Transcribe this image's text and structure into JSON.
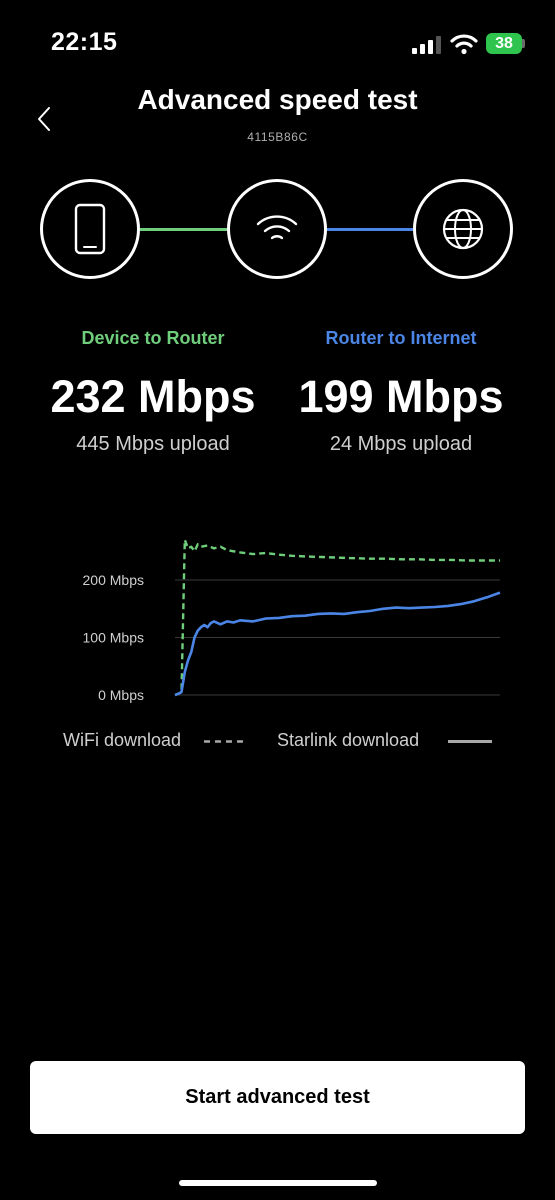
{
  "status_bar": {
    "time": "22:15",
    "battery": "38"
  },
  "header": {
    "title": "Advanced speed test",
    "serial": "4115B86C"
  },
  "icons": [
    "back-chevron-icon",
    "phone-icon",
    "wifi-icon",
    "globe-icon"
  ],
  "colors": {
    "wifi": "#6fce7b",
    "starlink": "#4b86e6",
    "background": "#000000"
  },
  "stats": {
    "device_to_router": {
      "label": "Device to Router",
      "download": "232 Mbps",
      "upload": "445 Mbps upload"
    },
    "router_to_internet": {
      "label": "Router to Internet",
      "download": "199 Mbps",
      "upload": "24 Mbps upload"
    }
  },
  "chart_data": {
    "type": "line",
    "y_ticks": [
      "0 Mbps",
      "100 Mbps",
      "200 Mbps"
    ],
    "ylim": [
      0,
      280
    ],
    "xlim": [
      0,
      100
    ],
    "grid": true,
    "legend_position": "bottom",
    "series": [
      {
        "name": "WiFi download",
        "style": "dashed",
        "color": "#6fce7b",
        "points": [
          [
            0,
            0
          ],
          [
            1,
            2
          ],
          [
            2,
            5
          ],
          [
            3,
            270
          ],
          [
            4,
            255
          ],
          [
            5,
            258
          ],
          [
            6,
            250
          ],
          [
            7,
            262
          ],
          [
            8,
            258
          ],
          [
            10,
            260
          ],
          [
            12,
            255
          ],
          [
            14,
            258
          ],
          [
            16,
            252
          ],
          [
            18,
            250
          ],
          [
            20,
            248
          ],
          [
            24,
            245
          ],
          [
            28,
            247
          ],
          [
            32,
            244
          ],
          [
            36,
            242
          ],
          [
            40,
            241
          ],
          [
            45,
            240
          ],
          [
            50,
            239
          ],
          [
            55,
            238
          ],
          [
            60,
            237
          ],
          [
            65,
            237
          ],
          [
            70,
            236
          ],
          [
            75,
            236
          ],
          [
            80,
            235
          ],
          [
            85,
            235
          ],
          [
            90,
            234
          ],
          [
            95,
            234
          ],
          [
            100,
            234
          ]
        ]
      },
      {
        "name": "Starlink download",
        "style": "solid",
        "color": "#4b86e6",
        "points": [
          [
            0,
            0
          ],
          [
            1,
            2
          ],
          [
            2,
            5
          ],
          [
            3,
            40
          ],
          [
            4,
            60
          ],
          [
            5,
            75
          ],
          [
            6,
            100
          ],
          [
            7,
            112
          ],
          [
            8,
            118
          ],
          [
            9,
            122
          ],
          [
            10,
            118
          ],
          [
            11,
            125
          ],
          [
            12,
            128
          ],
          [
            14,
            123
          ],
          [
            16,
            128
          ],
          [
            18,
            126
          ],
          [
            20,
            130
          ],
          [
            24,
            128
          ],
          [
            28,
            133
          ],
          [
            32,
            134
          ],
          [
            36,
            137
          ],
          [
            40,
            138
          ],
          [
            44,
            141
          ],
          [
            48,
            142
          ],
          [
            52,
            141
          ],
          [
            56,
            144
          ],
          [
            60,
            146
          ],
          [
            64,
            150
          ],
          [
            68,
            152
          ],
          [
            72,
            151
          ],
          [
            76,
            152
          ],
          [
            80,
            153
          ],
          [
            84,
            155
          ],
          [
            88,
            158
          ],
          [
            92,
            163
          ],
          [
            96,
            170
          ],
          [
            100,
            178
          ]
        ]
      }
    ]
  },
  "legend": {
    "wifi": "WiFi download",
    "starlink": "Starlink download"
  },
  "actions": {
    "start": "Start advanced test"
  }
}
